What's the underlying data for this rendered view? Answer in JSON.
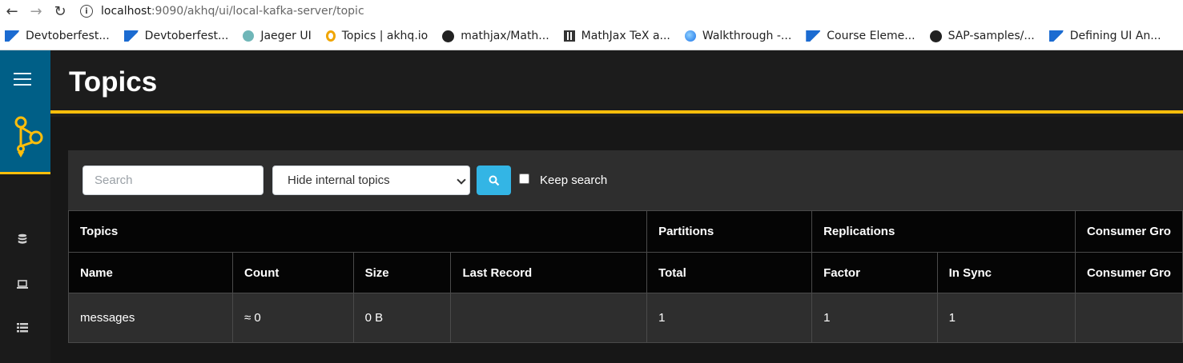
{
  "browser": {
    "url_host": "localhost",
    "url_path": ":9090/akhq/ui/local-kafka-server/topic",
    "bookmarks": [
      {
        "label": "Devtoberfest...",
        "icon": "sap-icon"
      },
      {
        "label": "Devtoberfest...",
        "icon": "sap-icon"
      },
      {
        "label": "Jaeger UI",
        "icon": "jaeger-icon"
      },
      {
        "label": "Topics | akhq.io",
        "icon": "kafka-icon"
      },
      {
        "label": "mathjax/Math...",
        "icon": "github-icon"
      },
      {
        "label": "MathJax TeX a...",
        "icon": "mathjax-icon"
      },
      {
        "label": "Walkthrough -...",
        "icon": "globe-icon"
      },
      {
        "label": "Course Eleme...",
        "icon": "sap-icon"
      },
      {
        "label": "SAP-samples/...",
        "icon": "github-icon"
      },
      {
        "label": "Defining UI An...",
        "icon": "sap-icon"
      }
    ]
  },
  "colors": {
    "accent": "#ffbe0b",
    "sidebar_top": "#005f87",
    "button": "#33b5e5"
  },
  "header": {
    "title": "Topics"
  },
  "toolbar": {
    "search_placeholder": "Search",
    "filter_selected": "Hide internal topics",
    "keep_search_label": "Keep search"
  },
  "table": {
    "groups": [
      "Topics",
      "Partitions",
      "Replications",
      "Consumer Gro"
    ],
    "columns": [
      "Name",
      "Count",
      "Size",
      "Last Record",
      "Total",
      "Factor",
      "In Sync",
      "Consumer Gro"
    ],
    "rows": [
      {
        "name": "messages",
        "count": "≈ 0",
        "size": "0 B",
        "last_record": "",
        "total": "1",
        "factor": "1",
        "in_sync": "1",
        "consumer_groups": ""
      }
    ]
  }
}
